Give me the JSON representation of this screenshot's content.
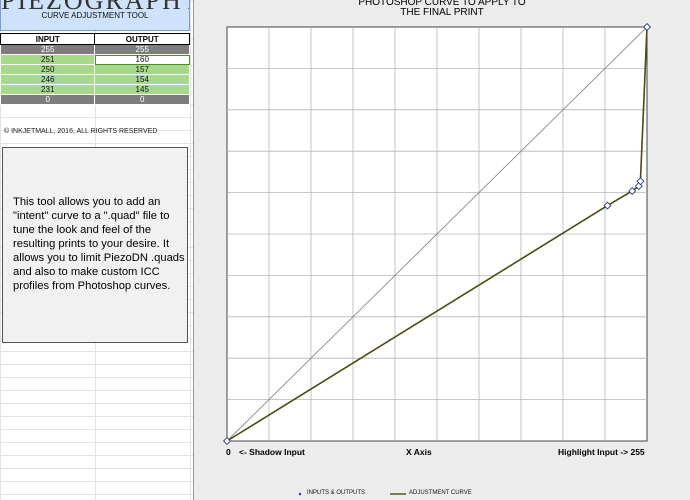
{
  "app": {
    "brand": "PIEZOGRAPHY",
    "subtitle": "CURVE ADJUSTMENT TOOL"
  },
  "table": {
    "headers": [
      "INPUT",
      "OUTPUT"
    ],
    "rows": [
      {
        "input": "255",
        "output": "255",
        "style": "dark"
      },
      {
        "input": "251",
        "output": "160",
        "style": "green"
      },
      {
        "input": "250",
        "output": "157",
        "style": "green"
      },
      {
        "input": "246",
        "output": "154",
        "style": "green"
      },
      {
        "input": "231",
        "output": "145",
        "style": "green"
      },
      {
        "input": "0",
        "output": "0",
        "style": "dark"
      }
    ]
  },
  "copyright": "© INKJETMALL, 2016, ALL RIGHTS RESERVED",
  "description": "This tool allows you to add an \"intent\" curve to a \".quad\" file to tune the look and feel of the resulting prints to your desire. It allows you to limit PiezoDN .quads and also to make custom ICC profiles from Photoshop curves.",
  "chart": {
    "title_line1": "PHOTOSHOP CURVE TO APPLY TO",
    "title_line2": "THE FINAL PRINT",
    "x_min_label": "0",
    "x_left_label": "<- Shadow Input",
    "x_axis_label": "X Axis",
    "x_right_label": "Highlight Input -> 255",
    "legend_points": "INPUTS & OUTPUTS",
    "legend_curve": "ADJUSTMENT CURVE",
    "colors": {
      "curve": "#4a4a12",
      "reference": "#8a8a8a",
      "marker": "#2b3a8f"
    }
  },
  "chart_data": {
    "type": "scatter",
    "xlim": [
      0,
      255
    ],
    "ylim": [
      0,
      255
    ],
    "grid": true,
    "series": [
      {
        "name": "INPUTS & OUTPUTS",
        "x": [
          0,
          231,
          246,
          250,
          251,
          255
        ],
        "y": [
          0,
          145,
          154,
          157,
          160,
          255
        ]
      }
    ],
    "reference_line": {
      "x": [
        0,
        255
      ],
      "y": [
        0,
        255
      ]
    }
  }
}
